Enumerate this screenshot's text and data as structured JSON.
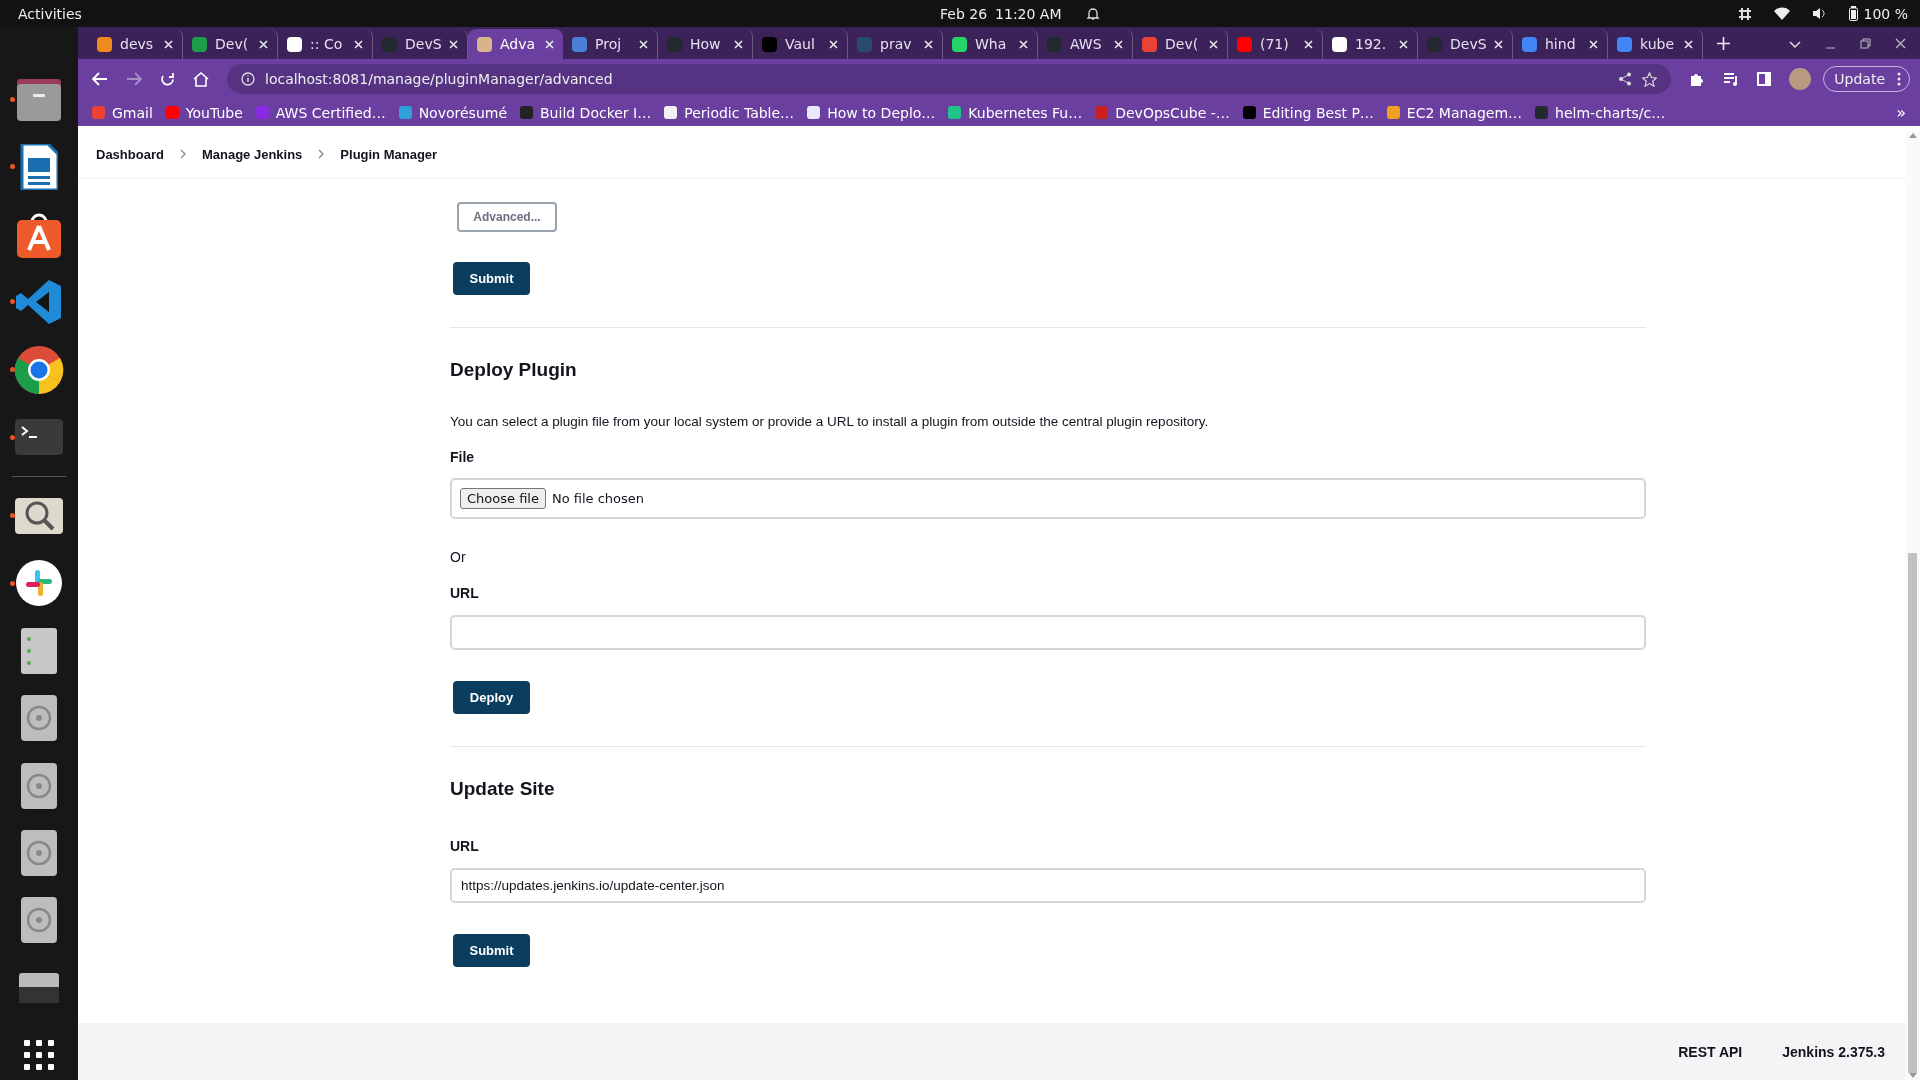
{
  "topbar": {
    "activities": "Activities",
    "date": "Feb 26",
    "time": "11:20 AM",
    "battery": "100 %"
  },
  "dock": [
    {
      "kind": "files",
      "running": true
    },
    {
      "kind": "writer",
      "running": true
    },
    {
      "kind": "store",
      "running": false
    },
    {
      "kind": "vscode",
      "running": true
    },
    {
      "kind": "chrome",
      "running": true
    },
    {
      "kind": "terminal",
      "running": true
    },
    {
      "kind": "separator"
    },
    {
      "kind": "viewer",
      "running": true
    },
    {
      "kind": "slack",
      "running": true
    },
    {
      "kind": "drive",
      "running": false
    },
    {
      "kind": "disc",
      "running": false
    },
    {
      "kind": "disc",
      "running": false
    },
    {
      "kind": "disc",
      "running": false
    },
    {
      "kind": "disc",
      "running": false
    },
    {
      "kind": "tray",
      "running": false
    },
    {
      "kind": "apps",
      "running": false
    }
  ],
  "browser": {
    "tabs": [
      {
        "title": "devs",
        "color": "#f28b1e",
        "selected": false
      },
      {
        "title": "Dev(",
        "color": "#1e9e4a",
        "selected": false
      },
      {
        "title": ":: Co",
        "color": "#ffffff",
        "selected": false
      },
      {
        "title": "DevS",
        "color": "#24292f",
        "selected": false
      },
      {
        "title": "Adva",
        "color": "#d9b48a",
        "selected": true
      },
      {
        "title": "Proj",
        "color": "#4a7fd6",
        "selected": false
      },
      {
        "title": "How",
        "color": "#24292f",
        "selected": false
      },
      {
        "title": "Vaul",
        "color": "#000000",
        "selected": false
      },
      {
        "title": "prav",
        "color": "#2a4a6a",
        "selected": false
      },
      {
        "title": "Wha",
        "color": "#25d366",
        "selected": false
      },
      {
        "title": "AWS",
        "color": "#24292f",
        "selected": false
      },
      {
        "title": "Dev(",
        "color": "#ea4335",
        "selected": false
      },
      {
        "title": "(71)",
        "color": "#ff0000",
        "selected": false
      },
      {
        "title": "192.",
        "color": "#ffffff",
        "selected": false
      },
      {
        "title": "DevS",
        "color": "#24292f",
        "selected": false
      },
      {
        "title": "hind",
        "color": "#4285f4",
        "selected": false
      },
      {
        "title": "kube",
        "color": "#4285f4",
        "selected": false
      }
    ],
    "url": "localhost:8081/manage/pluginManager/advanced",
    "update_button": "Update",
    "bookmarks": [
      {
        "label": "Gmail",
        "color": "#ea4335"
      },
      {
        "label": "YouTube",
        "color": "#ff0000"
      },
      {
        "label": "AWS Certified…",
        "color": "#8a2be2"
      },
      {
        "label": "Novorésumé",
        "color": "#2fa0d8"
      },
      {
        "label": "Build Docker I…",
        "color": "#222222"
      },
      {
        "label": "Periodic Table…",
        "color": "#f2f2f2"
      },
      {
        "label": "How to Deplo…",
        "color": "#e8e8ff"
      },
      {
        "label": "Kubernetes Fu…",
        "color": "#1fc48a"
      },
      {
        "label": "DevOpsCube -…",
        "color": "#cc1f1f"
      },
      {
        "label": "Editing Best P…",
        "color": "#000000"
      },
      {
        "label": "EC2 Managem…",
        "color": "#f0a020"
      },
      {
        "label": "helm-charts/c…",
        "color": "#24292f"
      }
    ],
    "more": "»"
  },
  "breadcrumbs": [
    "Dashboard",
    "Manage Jenkins",
    "Plugin Manager"
  ],
  "advanced_button": "Advanced...",
  "submit_button": "Submit",
  "deploy": {
    "heading": "Deploy Plugin",
    "description": "You can select a plugin file from your local system or provide a URL to install a plugin from outside the central plugin repository.",
    "file_label": "File",
    "choose_button": "Choose file",
    "file_status": "No file chosen",
    "or": "Or",
    "url_label": "URL",
    "button": "Deploy"
  },
  "update_site": {
    "heading": "Update Site",
    "url_label": "URL",
    "url_value": "https://updates.jenkins.io/update-center.json",
    "button": "Submit"
  },
  "footer": {
    "links": [
      "REST API",
      "Jenkins 2.375.3"
    ]
  }
}
